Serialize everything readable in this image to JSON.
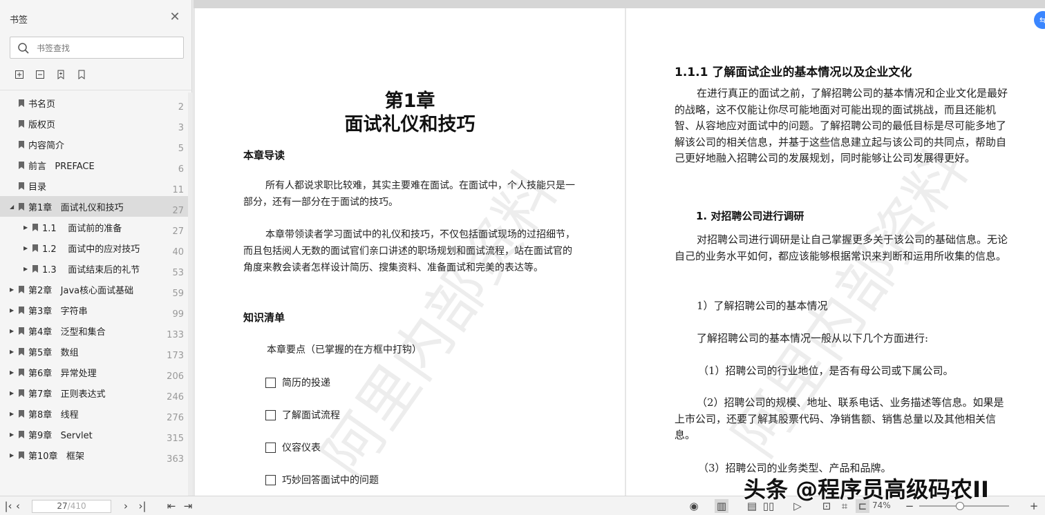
{
  "sidebar": {
    "title": "书签",
    "search_placeholder": "书签查找",
    "items": [
      {
        "label": "书名页",
        "page": "2",
        "level": 0,
        "arrow": "",
        "active": false
      },
      {
        "label": "版权页",
        "page": "3",
        "level": 0,
        "arrow": "",
        "active": false
      },
      {
        "label": "内容简介",
        "page": "5",
        "level": 0,
        "arrow": "",
        "active": false
      },
      {
        "label": "前言   PREFACE",
        "page": "6",
        "level": 0,
        "arrow": "",
        "active": false
      },
      {
        "label": "目录",
        "page": "11",
        "level": 0,
        "arrow": "",
        "active": false
      },
      {
        "label": "第1章   面试礼仪和技巧",
        "page": "27",
        "level": 0,
        "arrow": "◢",
        "active": true
      },
      {
        "label": "1.1    面试前的准备",
        "page": "27",
        "level": 1,
        "arrow": "▶",
        "active": false
      },
      {
        "label": "1.2    面试中的应对技巧",
        "page": "40",
        "level": 1,
        "arrow": "▶",
        "active": false
      },
      {
        "label": "1.3    面试结束后的礼节",
        "page": "53",
        "level": 1,
        "arrow": "▶",
        "active": false
      },
      {
        "label": "第2章   Java核心面试基础",
        "page": "59",
        "level": 0,
        "arrow": "▶",
        "active": false
      },
      {
        "label": "第3章   字符串",
        "page": "99",
        "level": 0,
        "arrow": "▶",
        "active": false
      },
      {
        "label": "第4章   泛型和集合",
        "page": "133",
        "level": 0,
        "arrow": "▶",
        "active": false
      },
      {
        "label": "第5章   数组",
        "page": "173",
        "level": 0,
        "arrow": "▶",
        "active": false
      },
      {
        "label": "第6章   异常处理",
        "page": "206",
        "level": 0,
        "arrow": "▶",
        "active": false
      },
      {
        "label": "第7章   正则表达式",
        "page": "246",
        "level": 0,
        "arrow": "▶",
        "active": false
      },
      {
        "label": "第8章   线程",
        "page": "276",
        "level": 0,
        "arrow": "▶",
        "active": false
      },
      {
        "label": "第9章   Servlet",
        "page": "315",
        "level": 0,
        "arrow": "▶",
        "active": false
      },
      {
        "label": "第10章   框架",
        "page": "363",
        "level": 0,
        "arrow": "▶",
        "active": false
      }
    ]
  },
  "left_page": {
    "chapter_number": "第1章",
    "chapter_title": "面试礼仪和技巧",
    "intro_heading": "本章导读",
    "intro_p1": "所有人都说求职比较难，其实主要难在面试。在面试中，个人技能只是一部分，还有一部分在于面试的技巧。",
    "intro_p2": "本章带领读者学习面试中的礼仪和技巧，不仅包括面试现场的过招细节，而且包括阅人无数的面试官们亲口讲述的职场规划和面试流程，站在面试官的角度来教会读者怎样设计简历、搜集资料、准备面试和完美的表达等。",
    "list_heading": "知识清单",
    "list_intro": "本章要点（已掌握的在方框中打钩）",
    "checklist": [
      "简历的投递",
      "了解面试流程",
      "仪容仪表",
      "巧妙回答面试中的问题"
    ],
    "watermark": "阿里内部资料"
  },
  "right_page": {
    "section_title": "1.1.1    了解面试企业的基本情况以及企业文化",
    "p1": "在进行真正的面试之前，了解招聘公司的基本情况和企业文化是最好的战略，这不仅能让你尽可能地面对可能出现的面试挑战，而且还能机智、从容地应对面试中的问题。了解招聘公司的最低目标是尽可能多地了解该公司的相关信息，并基于这些信息建立起与该公司的共同点，帮助自己更好地融入招聘公司的发展规划，同时能够让公司发展得更好。",
    "sub_heading": "1.  对招聘公司进行调研",
    "p2": "对招聘公司进行调研是让自己掌握更多关于该公司的基础信息。无论自己的业务水平如何，都应该能够根据常识来判断和运用所收集的信息。",
    "item_heading": "1）了解招聘公司的基本情况",
    "item_intro": "了解招聘公司的基本情况一般从以下几个方面进行:",
    "point1": "（1）招聘公司的行业地位，是否有母公司或下属公司。",
    "point2": "（2）招聘公司的规模、地址、联系电话、业务描述等信息。如果是上市公司，还要了解其股票代码、净销售额、销售总量以及其他相关信息。",
    "point3": "（3）招聘公司的业务类型、产品和品牌。",
    "watermark": "阿里内部资料"
  },
  "bottombar": {
    "current_page": "27",
    "total_pages": "/410",
    "zoom": "74%",
    "zoom_fraction": 0.45
  },
  "overlay": {
    "brand": "头条 @程序员高级码农II"
  },
  "colors": {
    "accent": "#3a86ff",
    "sidebar_bg": "#f5f5f5",
    "active_item": "#dcdcdc"
  }
}
